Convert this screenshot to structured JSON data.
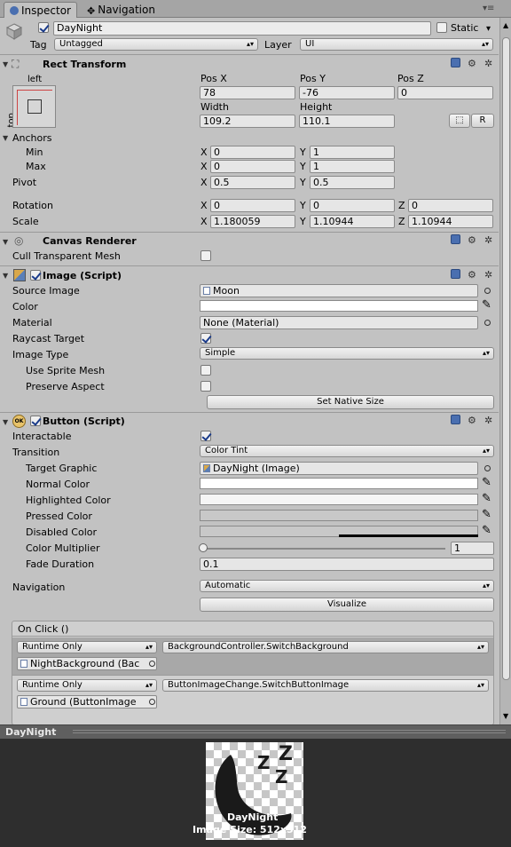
{
  "tabs": {
    "inspector": "Inspector",
    "navigation": "Navigation"
  },
  "object": {
    "name": "DayNight",
    "static_label": "Static",
    "tag_label": "Tag",
    "tag_value": "Untagged",
    "layer_label": "Layer",
    "layer_value": "UI"
  },
  "rect_transform": {
    "title": "Rect Transform",
    "anchor_preset_h": "left",
    "anchor_preset_v": "top",
    "posx_label": "Pos X",
    "posy_label": "Pos Y",
    "posz_label": "Pos Z",
    "posx": "78",
    "posy": "-76",
    "posz": "0",
    "width_label": "Width",
    "height_label": "Height",
    "width": "109.2",
    "height": "110.1",
    "raw_button": "R",
    "anchors_label": "Anchors",
    "min_label": "Min",
    "max_label": "Max",
    "min_x": "0",
    "min_y": "1",
    "max_x": "0",
    "max_y": "1",
    "pivot_label": "Pivot",
    "pivot_x": "0.5",
    "pivot_y": "0.5",
    "rotation_label": "Rotation",
    "rot_x": "0",
    "rot_y": "0",
    "rot_z": "0",
    "scale_label": "Scale",
    "scale_x": "1.180059",
    "scale_y": "1.10944",
    "scale_z": "1.10944",
    "x": "X",
    "y": "Y",
    "z": "Z"
  },
  "canvas_renderer": {
    "title": "Canvas Renderer",
    "cull_label": "Cull Transparent Mesh"
  },
  "image": {
    "title": "Image (Script)",
    "source_label": "Source Image",
    "source_value": "Moon",
    "color_label": "Color",
    "material_label": "Material",
    "material_value": "None (Material)",
    "raycast_label": "Raycast Target",
    "type_label": "Image Type",
    "type_value": "Simple",
    "sprite_mesh_label": "Use Sprite Mesh",
    "preserve_label": "Preserve Aspect",
    "native_button": "Set Native Size"
  },
  "button": {
    "title": "Button (Script)",
    "interactable_label": "Interactable",
    "transition_label": "Transition",
    "transition_value": "Color Tint",
    "target_label": "Target Graphic",
    "target_value": "DayNight (Image)",
    "normal_label": "Normal Color",
    "highlighted_label": "Highlighted Color",
    "pressed_label": "Pressed Color",
    "disabled_label": "Disabled Color",
    "multiplier_label": "Color Multiplier",
    "multiplier_value": "1",
    "fade_label": "Fade Duration",
    "fade_value": "0.1",
    "navigation_label": "Navigation",
    "navigation_value": "Automatic",
    "visualize_button": "Visualize"
  },
  "onclick": {
    "title": "On Click ()",
    "entries": [
      {
        "mode": "Runtime Only",
        "function": "BackgroundController.SwitchBackground",
        "target": "NightBackground (Bac"
      },
      {
        "mode": "Runtime Only",
        "function": "ButtonImageChange.SwitchButtonImage",
        "target": "Ground (ButtonImage"
      }
    ]
  },
  "preview": {
    "title": "DayNight",
    "name": "DayNight",
    "size_text": "Image Size: 512x512"
  },
  "colors": {
    "accent": "#4a6fb0",
    "panel": "#c2c2c2",
    "preview_bg": "#2e2e2e"
  },
  "icons": [
    "gameobject-cube-icon",
    "navigation-icon",
    "menu-icon",
    "help-icon",
    "settings-icon",
    "eyedropper-icon",
    "object-picker-icon"
  ]
}
